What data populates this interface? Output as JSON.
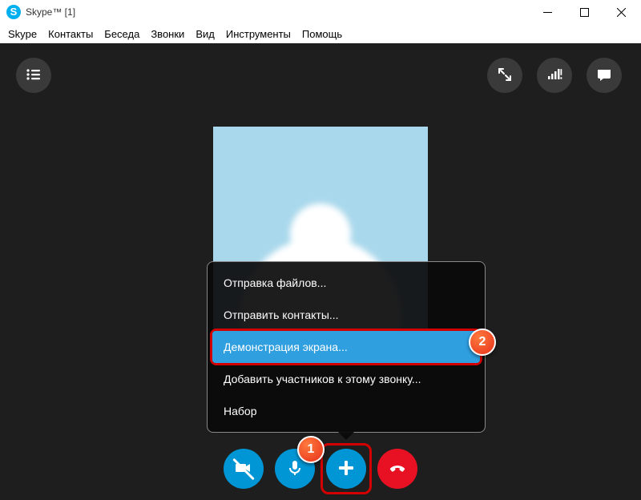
{
  "window": {
    "title": "Skype™ [1]"
  },
  "menu": {
    "items": [
      "Skype",
      "Контакты",
      "Беседа",
      "Звонки",
      "Вид",
      "Инструменты",
      "Помощь"
    ]
  },
  "popover": {
    "items": [
      {
        "label": "Отправка файлов...",
        "selected": false,
        "highlighted": false
      },
      {
        "label": "Отправить контакты...",
        "selected": false,
        "highlighted": false
      },
      {
        "label": "Демонстрация экрана...",
        "selected": true,
        "highlighted": true
      },
      {
        "label": "Добавить участников к этому звонку...",
        "selected": false,
        "highlighted": false
      },
      {
        "label": "Набор",
        "selected": false,
        "highlighted": false
      }
    ]
  },
  "callouts": {
    "one": "1",
    "two": "2"
  }
}
